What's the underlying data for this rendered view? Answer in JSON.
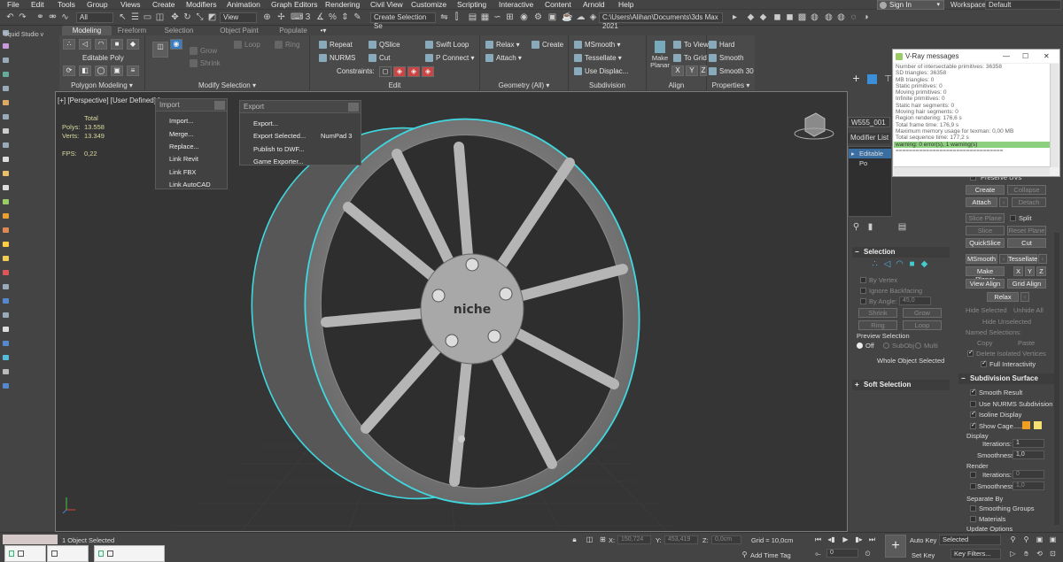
{
  "menu": [
    "File",
    "Edit",
    "Tools",
    "Group",
    "Views",
    "Create",
    "Modifiers",
    "Animation",
    "Graph Editors",
    "Rendering",
    "Civil View",
    "Customize",
    "Scripting",
    "Interactive",
    "Content",
    "Arnold",
    "Help"
  ],
  "account": {
    "sign_in": "Sign In",
    "workspaces_label": "Workspaces:",
    "workspace": "Default"
  },
  "toolbar": {
    "filter": "All",
    "ref_coord": "View",
    "selection_set": "Create Selection Se",
    "path": "C:\\Users\\Alihan\\Documents\\3ds Max 2021"
  },
  "side_label": "Squid Studio v",
  "ribbon": {
    "tabs": [
      "Modeling",
      "Freeform",
      "Selection",
      "Object Paint",
      "Populate"
    ],
    "object_type": "Editable Poly",
    "groups": {
      "polygon_modeling": "Polygon Modeling",
      "modify_selection": "Modify Selection",
      "edit": "Edit",
      "geometry": "Geometry (All)",
      "subdivision": "Subdivision",
      "align": "Align",
      "properties": "Properties"
    },
    "modify": {
      "grow": "Grow",
      "shrink": "Shrink",
      "loop": "Loop",
      "ring": "Ring"
    },
    "edit": {
      "repeat": "Repeat",
      "qslice": "QSlice",
      "swift_loop": "Swift Loop",
      "nurms": "NURMS",
      "cut": "Cut",
      "p_connect": "P Connect",
      "constraints": "Constraints:"
    },
    "geometry": {
      "relax": "Relax",
      "create": "Create",
      "attach": "Attach"
    },
    "subdivision": {
      "msmooth": "MSmooth",
      "tessellate": "Tessellate",
      "use_displace": "Use Displac..."
    },
    "align": {
      "make_planar": "Make\nPlanar",
      "to_view": "To View",
      "to_grid": "To Grid",
      "x": "X",
      "y": "Y",
      "z": "Z"
    },
    "properties": {
      "hard": "Hard",
      "smooth": "Smooth",
      "smooth30": "Smooth 30"
    }
  },
  "viewport": {
    "label": "[+] [Perspective] [User Defined] [",
    "stats": {
      "total": "Total",
      "polys_label": "Polys:",
      "polys": "13.558",
      "verts_label": "Verts:",
      "verts": "13.349",
      "fps_label": "FPS:",
      "fps": "0,22"
    },
    "brand": "niche"
  },
  "import_menu": {
    "title": "Import",
    "items": [
      "Import...",
      "Merge...",
      "Replace...",
      "Link Revit",
      "Link FBX",
      "Link AutoCAD"
    ]
  },
  "export_menu": {
    "title": "Export",
    "items": [
      "Export...",
      "Export Selected...",
      "Publish to DWF...",
      "Game Exporter..."
    ],
    "shortcut": "NumPad 3"
  },
  "vray": {
    "title": "V-Ray messages",
    "lines": [
      "Number of intersectable primitives: 36358",
      "SD triangles: 36358",
      "MB triangles: 0",
      "Static primitives: 0",
      "Moving primitives: 0",
      "Infinite primitives: 0",
      "Static hair segments: 0",
      "Moving hair segments: 0",
      "Region rendering: 176,6 s",
      "Total frame time: 176,9 s",
      "Maximum memory usage for texman: 0,00 MB",
      "Total sequence time: 177,2 s"
    ],
    "warning": "warning: 0 error(s), 1 warning(s)",
    "separator": "================================"
  },
  "modifier_panel": {
    "object_name": "W555_001",
    "list_label": "Modifier List",
    "stack_item": "Editable Po"
  },
  "selection_rollout": {
    "title": "Selection",
    "by_vertex": "By Vertex",
    "ignore_backfacing": "Ignore Backfacing",
    "by_angle": "By Angle:",
    "angle_value": "45,0",
    "shrink": "Shrink",
    "grow": "Grow",
    "ring": "Ring",
    "loop": "Loop",
    "preview_selection": "Preview Selection",
    "off": "Off",
    "subobj": "SubObj",
    "multi": "Multi",
    "whole_object": "Whole Object Selected"
  },
  "soft_selection": {
    "title": "Soft Selection"
  },
  "edit_geometry": {
    "preserve_uvs": "Preserve UVs",
    "create": "Create",
    "collapse": "Collapse",
    "attach": "Attach",
    "detach": "Detach",
    "slice_plane": "Slice Plane",
    "split": "Split",
    "slice": "Slice",
    "reset_plane": "Reset Plane",
    "quickslice": "QuickSlice",
    "cut": "Cut",
    "msmooth": "MSmooth",
    "tessellate": "Tessellate",
    "make_planar": "Make Planar",
    "x": "X",
    "y": "Y",
    "z": "Z",
    "view_align": "View Align",
    "grid_align": "Grid Align",
    "relax": "Relax",
    "hide_selected": "Hide Selected",
    "unhide_all": "Unhide All",
    "hide_unselected": "Hide Unselected",
    "named_selections": "Named Selections:",
    "copy": "Copy",
    "paste": "Paste",
    "delete_isolated": "Delete Isolated Vertices",
    "full_interactivity": "Full Interactivity"
  },
  "subdivision_surface": {
    "title": "Subdivision Surface",
    "smooth_result": "Smooth Result",
    "use_nurms": "Use NURMS Subdivision",
    "isoline_display": "Isoline Display",
    "show_cage": "Show Cage......",
    "display": "Display",
    "iterations_label": "Iterations:",
    "iterations": "1",
    "smoothness_label": "Smoothness:",
    "smoothness": "1,0",
    "render": "Render",
    "r_iterations": "0",
    "r_smoothness": "1,0",
    "separate_by": "Separate By",
    "smoothing_groups": "Smoothing Groups",
    "materials": "Materials",
    "update_options": "Update Options"
  },
  "status": {
    "selected": "1 Object Selected",
    "x_label": "X:",
    "x": "150,724",
    "y_label": "Y:",
    "y": "453,419",
    "z_label": "Z:",
    "z": "0,0cm",
    "grid": "Grid = 10,0cm",
    "add_time_tag": "Add Time Tag",
    "auto_key": "Auto Key",
    "set_key": "Set Key",
    "selected_mode": "Selected",
    "key_filters": "Key Filters...",
    "frame": "0"
  },
  "colors": {
    "accent": "#3a8fd8",
    "selection_outline": "#40d8e0",
    "warning_bar": "#8ccf7e",
    "cage_orange": "#f0a020",
    "cage_yellow": "#f5e070"
  }
}
